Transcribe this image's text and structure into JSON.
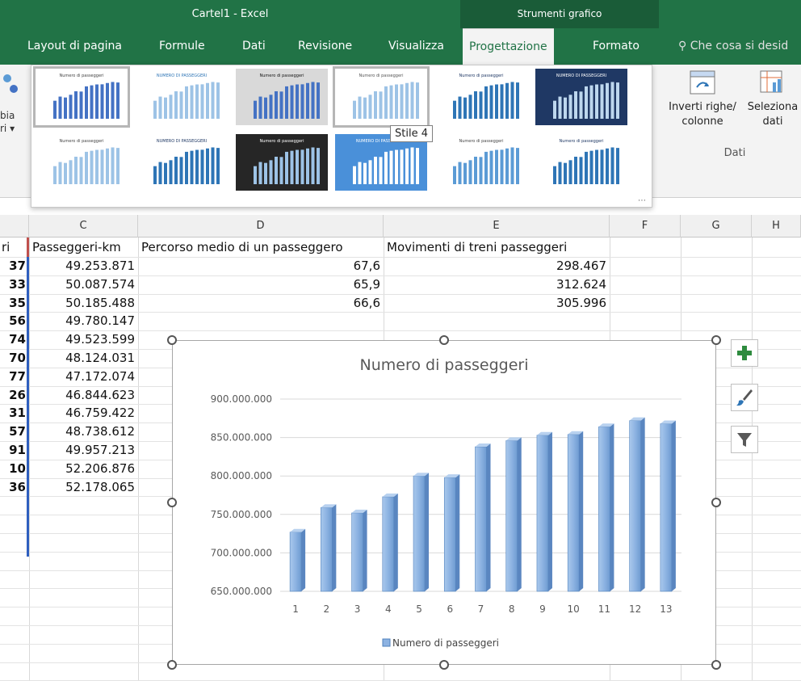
{
  "window": {
    "title": "Cartel1 - Excel",
    "tool_group": "Strumenti grafico"
  },
  "tabs": [
    "Layout di pagina",
    "Formule",
    "Dati",
    "Revisione",
    "Visualizza",
    "Progettazione",
    "Formato"
  ],
  "active_tab": "Progettazione",
  "help_search": "Che cosa si desid",
  "ribbon_left": {
    "line1": "bia",
    "line2": "ri ▾"
  },
  "gallery": {
    "tooltip": "Stile 4",
    "thumbnail_titles": [
      "Numero di passeggeri",
      "NUMERO DI PASSEGGERI",
      "Numero di passeggeri",
      "Numero di passeggeri",
      "Numero di passeggeri",
      "NUMERO DI PASSEGGERI",
      "Numero di passeggeri",
      "NUMERO DI PASSEGGERI",
      "Numero di passeggeri",
      "NUMERO DI PASSEGGERI",
      "Numero di passeggeri",
      "Numero di passeggeri"
    ]
  },
  "data_group": {
    "switch_label_1": "Inverti righe/",
    "switch_label_2": "colonne",
    "select_label_1": "Seleziona",
    "select_label_2": "dati",
    "group_label": "Dati"
  },
  "columns": [
    "C",
    "D",
    "E",
    "F",
    "G",
    "H"
  ],
  "headers": {
    "b_partial": "ri",
    "c": "Passeggeri-km",
    "d": "Percorso medio di un passeggero",
    "e": "Movimenti di treni passeggeri"
  },
  "col_b_partial": [
    "37",
    "33",
    "35",
    "56",
    "74",
    "70",
    "77",
    "26",
    "31",
    "57",
    "91",
    "10",
    "36"
  ],
  "col_c": [
    "49.253.871",
    "50.087.574",
    "50.185.488",
    "49.780.147",
    "49.523.599",
    "48.124.031",
    "47.172.074",
    "46.844.623",
    "46.759.422",
    "48.738.612",
    "49.957.213",
    "52.206.876",
    "52.178.065"
  ],
  "col_d": [
    "67,6",
    "65,9",
    "66,6"
  ],
  "col_e": [
    "298.467",
    "312.624",
    "305.996"
  ],
  "colors": {
    "excel_green": "#217346",
    "bar": "#8db3e2",
    "bar_dark": "#4f81bd"
  },
  "chart_data": {
    "type": "bar",
    "title": "Numero di passeggeri",
    "categories": [
      "1",
      "2",
      "3",
      "4",
      "5",
      "6",
      "7",
      "8",
      "9",
      "10",
      "11",
      "12",
      "13"
    ],
    "series": [
      {
        "name": "Numero di passeggeri",
        "values": [
          727000000,
          759000000,
          752000000,
          773000000,
          800000000,
          798000000,
          838000000,
          846000000,
          853000000,
          854000000,
          864000000,
          872000000,
          868000000
        ]
      }
    ],
    "y_tick_labels": [
      "900.000.000",
      "850.000.000",
      "800.000.000",
      "750.000.000",
      "700.000.000",
      "650.000.000"
    ],
    "ylim": [
      650000000,
      900000000
    ],
    "grid": true,
    "legend": "bottom"
  }
}
